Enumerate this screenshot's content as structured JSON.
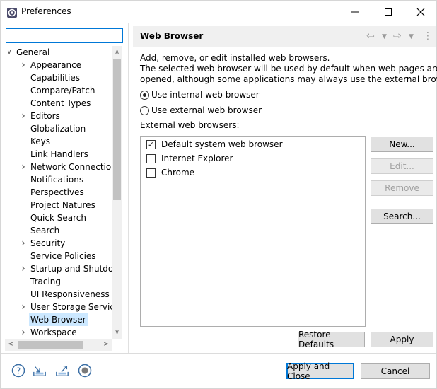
{
  "window": {
    "title": "Preferences",
    "minimize_icon": "minimize-icon",
    "maximize_icon": "maximize-icon",
    "close_icon": "close-icon"
  },
  "filter": {
    "value": "",
    "placeholder": ""
  },
  "tree": {
    "items": [
      {
        "label": "General",
        "level": 0,
        "expandable": true,
        "expanded": true,
        "selected": false
      },
      {
        "label": "Appearance",
        "level": 1,
        "expandable": true,
        "expanded": false,
        "selected": false
      },
      {
        "label": "Capabilities",
        "level": 1,
        "expandable": false,
        "expanded": false,
        "selected": false
      },
      {
        "label": "Compare/Patch",
        "level": 1,
        "expandable": false,
        "expanded": false,
        "selected": false
      },
      {
        "label": "Content Types",
        "level": 1,
        "expandable": false,
        "expanded": false,
        "selected": false
      },
      {
        "label": "Editors",
        "level": 1,
        "expandable": true,
        "expanded": false,
        "selected": false
      },
      {
        "label": "Globalization",
        "level": 1,
        "expandable": false,
        "expanded": false,
        "selected": false
      },
      {
        "label": "Keys",
        "level": 1,
        "expandable": false,
        "expanded": false,
        "selected": false
      },
      {
        "label": "Link Handlers",
        "level": 1,
        "expandable": false,
        "expanded": false,
        "selected": false
      },
      {
        "label": "Network Connections",
        "level": 1,
        "expandable": true,
        "expanded": false,
        "selected": false
      },
      {
        "label": "Notifications",
        "level": 1,
        "expandable": false,
        "expanded": false,
        "selected": false
      },
      {
        "label": "Perspectives",
        "level": 1,
        "expandable": false,
        "expanded": false,
        "selected": false
      },
      {
        "label": "Project Natures",
        "level": 1,
        "expandable": false,
        "expanded": false,
        "selected": false
      },
      {
        "label": "Quick Search",
        "level": 1,
        "expandable": false,
        "expanded": false,
        "selected": false
      },
      {
        "label": "Search",
        "level": 1,
        "expandable": false,
        "expanded": false,
        "selected": false
      },
      {
        "label": "Security",
        "level": 1,
        "expandable": true,
        "expanded": false,
        "selected": false
      },
      {
        "label": "Service Policies",
        "level": 1,
        "expandable": false,
        "expanded": false,
        "selected": false
      },
      {
        "label": "Startup and Shutdown",
        "level": 1,
        "expandable": true,
        "expanded": false,
        "selected": false
      },
      {
        "label": "Tracing",
        "level": 1,
        "expandable": false,
        "expanded": false,
        "selected": false
      },
      {
        "label": "UI Responsiveness Monitoring",
        "level": 1,
        "expandable": false,
        "expanded": false,
        "selected": false
      },
      {
        "label": "User Storage Service",
        "level": 1,
        "expandable": true,
        "expanded": false,
        "selected": false
      },
      {
        "label": "Web Browser",
        "level": 1,
        "expandable": false,
        "expanded": false,
        "selected": true
      },
      {
        "label": "Workspace",
        "level": 1,
        "expandable": true,
        "expanded": false,
        "selected": false
      }
    ]
  },
  "page": {
    "title": "Web Browser",
    "back_icon": "back-arrow-icon",
    "forward_icon": "forward-arrow-icon",
    "menu_icon": "view-menu-icon",
    "description_line1": "Add, remove, or edit installed web browsers.",
    "description_line2": "The selected web browser will be used by default when web pages are",
    "description_line3": "opened, although some applications may always use the external browser.",
    "radio_internal": "Use internal web browser",
    "radio_external": "Use external web browser",
    "radio_internal_selected": true,
    "list_label": "External web browsers:",
    "browsers": [
      {
        "label": "Default system web browser",
        "checked": true
      },
      {
        "label": "Internet Explorer",
        "checked": false
      },
      {
        "label": "Chrome",
        "checked": false
      }
    ],
    "buttons": {
      "new": "New...",
      "edit": "Edit...",
      "remove": "Remove",
      "search": "Search...",
      "restore_defaults": "Restore Defaults",
      "apply": "Apply"
    }
  },
  "footer": {
    "help_icon": "help-icon",
    "import_icon": "import-icon",
    "export_icon": "export-icon",
    "record_icon": "record-icon",
    "apply_close": "Apply and Close",
    "cancel": "Cancel"
  },
  "colors": {
    "accent": "#0078d7",
    "selection": "#cce8ff",
    "header_bg": "#f0f0f0"
  }
}
